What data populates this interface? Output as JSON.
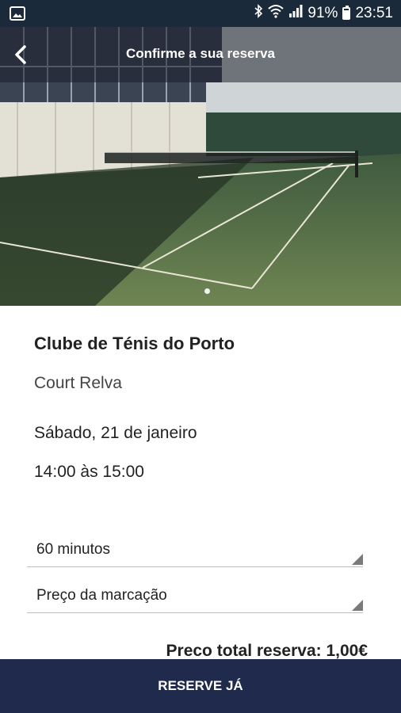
{
  "status_bar": {
    "battery": "91%",
    "time": "23:51",
    "icons": [
      "image-notification-icon",
      "bluetooth-icon",
      "wifi-icon",
      "signal-icon",
      "battery-icon"
    ]
  },
  "header": {
    "title": "Confirme a sua reserva",
    "back_icon": "back-arrow-icon"
  },
  "hero": {
    "image_description": "tennis-court-photo",
    "pager_total": 1,
    "pager_active": 1
  },
  "booking": {
    "club": "Clube de Ténis do Porto",
    "court": "Court Relva",
    "date": "Sábado, 21 de janeiro",
    "time": "14:00 às 15:00"
  },
  "options": {
    "duration": "60 minutos",
    "price_type": "Preço da marcação"
  },
  "total": "Preco total reserva: 1,00€",
  "reserve_button": "RESERVE JÁ",
  "colors": {
    "primary": "#202a4d",
    "status_bar": "#1a2a3a"
  }
}
